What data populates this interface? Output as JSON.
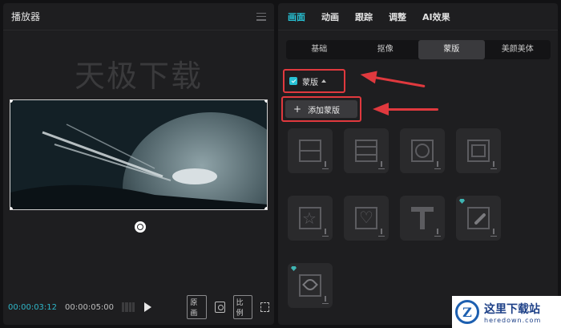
{
  "player": {
    "title": "播放器",
    "watermark": "天极下载",
    "time_current": "00:00:03:12",
    "time_total": "00:00:05:00",
    "ratio_original": "原画",
    "ratio_label": "比例"
  },
  "props": {
    "tabs": [
      {
        "label": "画面",
        "active": true
      },
      {
        "label": "动画",
        "active": false
      },
      {
        "label": "跟踪",
        "active": false
      },
      {
        "label": "调整",
        "active": false
      },
      {
        "label": "AI效果",
        "active": false
      }
    ],
    "subtabs": [
      {
        "label": "基础",
        "active": false
      },
      {
        "label": "抠像",
        "active": false
      },
      {
        "label": "蒙版",
        "active": true
      },
      {
        "label": "美颜美体",
        "active": false
      }
    ],
    "mask_toggle_label": "蒙版",
    "mask_toggle_checked": true,
    "add_mask_label": "添加蒙版",
    "mask_presets": [
      {
        "icon": "line-mask-icon"
      },
      {
        "icon": "mirror-mask-icon"
      },
      {
        "icon": "circle-mask-icon"
      },
      {
        "icon": "rectangle-mask-icon"
      },
      {
        "icon": "star-mask-icon"
      },
      {
        "icon": "heart-mask-icon"
      },
      {
        "icon": "text-mask-icon"
      },
      {
        "icon": "brush-mask-icon",
        "premium": true
      },
      {
        "icon": "pen-mask-icon",
        "premium": true
      }
    ]
  },
  "logo": {
    "cn": "这里下载站",
    "en": "heredown.com"
  },
  "colors": {
    "accent": "#27c1d4",
    "highlight": "#e0393e",
    "panel": "#1e1e20"
  }
}
